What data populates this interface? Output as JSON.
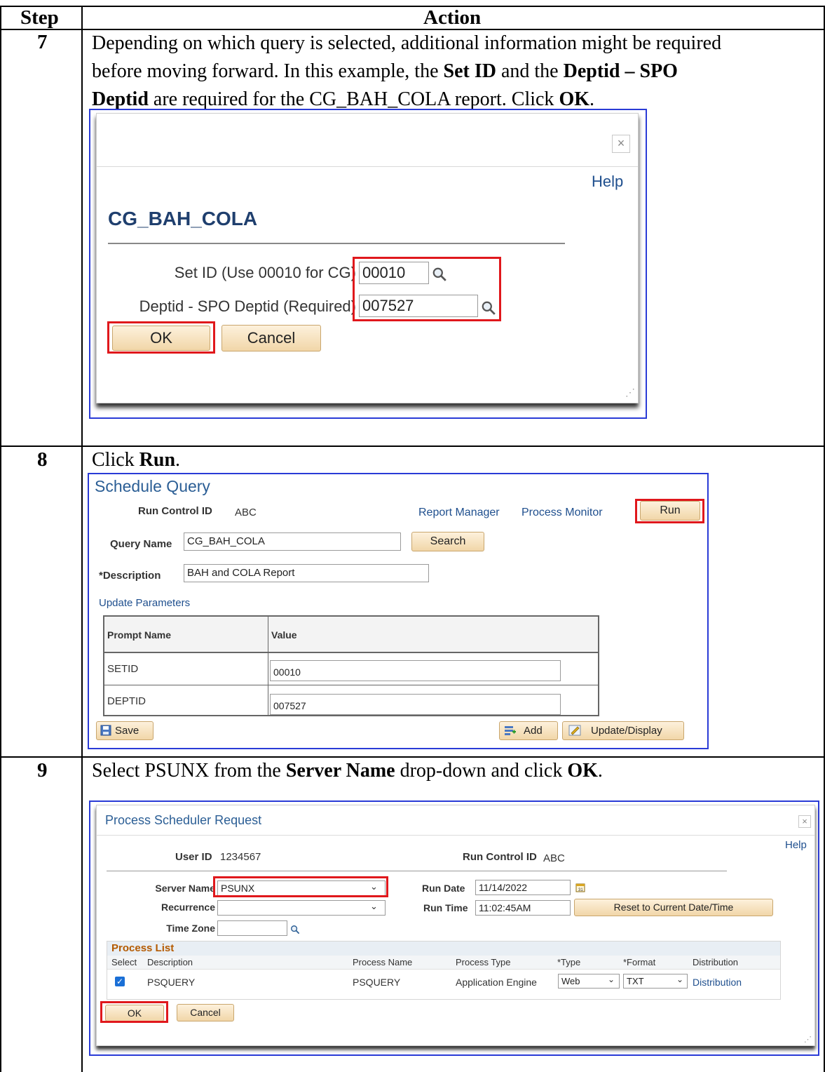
{
  "header": {
    "step": "Step",
    "action": "Action"
  },
  "step7": {
    "number": "7",
    "line1": "Depending on which query is selected, additional information might be required",
    "line2_a": "before moving forward. In this example, the ",
    "line2_b": "Set ID",
    "line2_c": " and the ",
    "line2_d": "Deptid – SPO",
    "line3_a": "Deptid",
    "line3_b": " are required for the CG_BAH_COLA report. Click ",
    "line3_c": "OK",
    "line3_d": ".",
    "dialog": {
      "help": "Help",
      "title": "CG_BAH_COLA",
      "setid_label": "Set ID (Use 00010 for CG)",
      "setid_value": "00010",
      "deptid_label": "Deptid - SPO Deptid (Required)",
      "deptid_value": "007527",
      "ok": "OK",
      "cancel": "Cancel"
    }
  },
  "step8": {
    "number": "8",
    "text_a": "Click ",
    "text_b": "Run",
    "text_c": ".",
    "panel": {
      "title": "Schedule Query",
      "run_control_label": "Run Control ID",
      "run_control_value": "ABC",
      "report_manager": "Report Manager",
      "process_monitor": "Process Monitor",
      "run": "Run",
      "query_name_label": "Query Name",
      "query_name_value": "CG_BAH_COLA",
      "search": "Search",
      "description_label": "*Description",
      "description_value": "BAH and COLA Report",
      "update_parameters": "Update Parameters",
      "col_prompt": "Prompt Name",
      "col_value": "Value",
      "rows": [
        {
          "prompt": "SETID",
          "value": "00010"
        },
        {
          "prompt": "DEPTID",
          "value": "007527"
        }
      ],
      "save": "Save",
      "add": "Add",
      "update_display": "Update/Display"
    }
  },
  "step9": {
    "number": "9",
    "text_a": "Select PSUNX from the ",
    "text_b": "Server Name",
    "text_c": " drop-down and click ",
    "text_d": "OK",
    "text_e": ".",
    "dialog": {
      "title": "Process Scheduler Request",
      "help": "Help",
      "user_id_label": "User ID",
      "user_id_value": "1234567",
      "run_control_label": "Run Control ID",
      "run_control_value": "ABC",
      "server_name_label": "Server Name",
      "server_name_value": "PSUNX",
      "run_date_label": "Run Date",
      "run_date_value": "11/14/2022",
      "recurrence_label": "Recurrence",
      "recurrence_value": "",
      "run_time_label": "Run Time",
      "run_time_value": "11:02:45AM",
      "reset_button": "Reset to Current Date/Time",
      "time_zone_label": "Time Zone",
      "process_list_title": "Process List",
      "columns": [
        "Select",
        "Description",
        "Process Name",
        "Process Type",
        "*Type",
        "*Format",
        "Distribution"
      ],
      "row": {
        "description": "PSQUERY",
        "process_name": "PSQUERY",
        "process_type": "Application Engine",
        "type": "Web",
        "format": "TXT",
        "distribution": "Distribution"
      },
      "ok": "OK",
      "cancel": "Cancel"
    }
  }
}
